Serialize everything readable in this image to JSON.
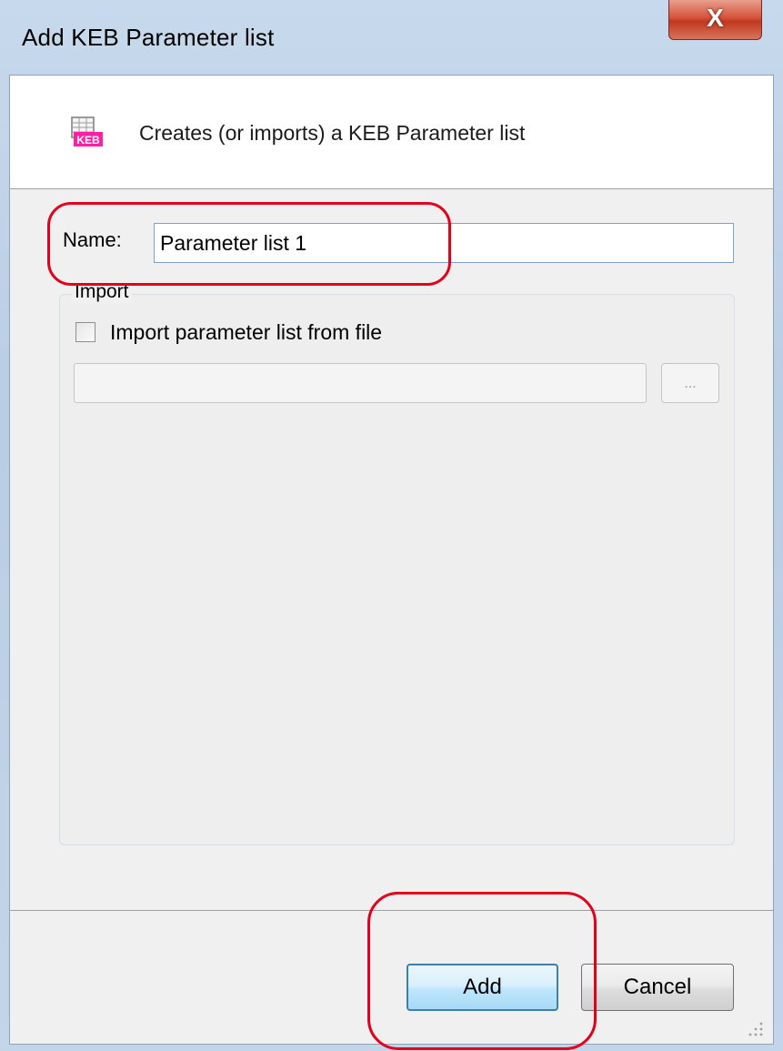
{
  "window": {
    "title": "Add KEB Parameter list",
    "close_label": "X"
  },
  "header": {
    "icon": "keb-parameter-list-icon",
    "icon_text": "KEB",
    "description": "Creates (or imports) a KEB Parameter list"
  },
  "form": {
    "name_label": "Name:",
    "name_value": "Parameter list 1",
    "import_group": {
      "legend": "Import",
      "checkbox_label": "Import parameter list from file",
      "checkbox_checked": false,
      "path_value": "",
      "browse_label": "..."
    }
  },
  "buttons": {
    "add_label": "Add",
    "cancel_label": "Cancel"
  },
  "colors": {
    "annotation": "#e3001b",
    "icon_accent": "#ff1fa5"
  }
}
